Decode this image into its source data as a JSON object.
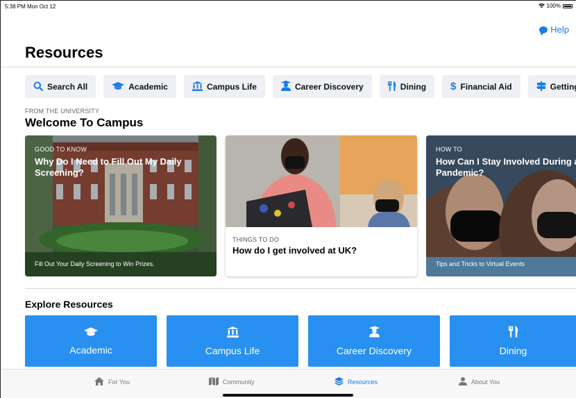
{
  "status": {
    "time": "5:38 PM  Mon Oct 12",
    "battery": "100%"
  },
  "help_label": "Help",
  "page_title": "Resources",
  "categories": [
    {
      "icon": "search-icon",
      "label": "Search All"
    },
    {
      "icon": "graduation-cap-icon",
      "label": "Academic"
    },
    {
      "icon": "university-icon",
      "label": "Campus Life"
    },
    {
      "icon": "user-graduate-icon",
      "label": "Career Discovery"
    },
    {
      "icon": "utensils-icon",
      "label": "Dining"
    },
    {
      "icon": "dollar-icon",
      "label": "Financial Aid"
    },
    {
      "icon": "signpost-icon",
      "label": "Getting Aro"
    }
  ],
  "welcome": {
    "kicker": "FROM THE UNIVERSITY",
    "title": "Welcome To Campus",
    "cards": [
      {
        "kicker": "GOOD TO KNOW",
        "headline": "Why Do I Need to Fill Out My Daily Screening?",
        "footer": "Fill Out Your Daily Screening to Win Prizes."
      },
      {
        "kicker": "THINGS TO DO",
        "headline": "How do I get involved at UK?",
        "footer": ""
      },
      {
        "kicker": "HOW TO",
        "headline": "How Can I Stay Involved During a Pandemic?",
        "footer": "Tips and Tricks to Virtual Events"
      }
    ]
  },
  "explore": {
    "title": "Explore Resources",
    "tiles": [
      {
        "icon": "graduation-cap-icon",
        "label": "Academic"
      },
      {
        "icon": "university-icon",
        "label": "Campus Life"
      },
      {
        "icon": "user-graduate-icon",
        "label": "Career Discovery"
      },
      {
        "icon": "utensils-icon",
        "label": "Dining"
      }
    ]
  },
  "tabs": [
    {
      "icon": "home-icon",
      "label": "For You",
      "active": false
    },
    {
      "icon": "map-icon",
      "label": "Community",
      "active": false
    },
    {
      "icon": "layers-icon",
      "label": "Resources",
      "active": true
    },
    {
      "icon": "person-icon",
      "label": "About You",
      "active": false
    }
  ],
  "colors": {
    "accent": "#1a7ce8",
    "tile": "#2790f0",
    "pill_bg": "#eef0f5"
  }
}
